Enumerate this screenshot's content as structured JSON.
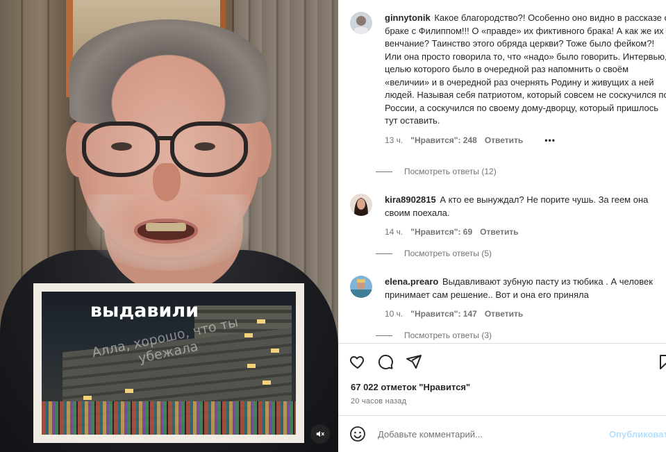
{
  "video": {
    "overlay_title": "выдавили",
    "projection_text": "Алла, хорошо, что ты убежала"
  },
  "comments": [
    {
      "username": "ginnytonik",
      "text": "Какое благородство?! Особенно оно видно в рассказе о браке с Филиппом!!! О «правде» их фиктивного брака! А как же их венчание? Таинство этого обряда церкви? Тоже было фейком?! Или она просто говорила то, что «надо» было говорить. Интервью, целью которого было в очередной раз напомнить о своём «величии» и в очередной раз очернять Родину и живущих а ней людей. Называя себя патриотом, который совсем не соскучился по России, а соскучился по своему дому-дворцу, который пришлось тут оставить.",
      "time": "13 ч.",
      "likes": "\"Нравится\": 248",
      "reply": "Ответить",
      "more": "•••",
      "view_replies": "Посмотреть ответы (12)"
    },
    {
      "username": "kira8902815",
      "text": "А кто ее вынуждал? Не порите чушь. За геем она своим поехала.",
      "time": "14 ч.",
      "likes": "\"Нравится\": 69",
      "reply": "Ответить",
      "view_replies": "Посмотреть ответы (5)"
    },
    {
      "username": "elena.prearo",
      "text": "Выдавливают зубную пасту из тюбика . А человек принимает сам решение.. Вот и она его приняла",
      "time": "10 ч.",
      "likes": "\"Нравится\": 147",
      "reply": "Ответить",
      "view_replies": "Посмотреть ответы (3)"
    }
  ],
  "actions": {
    "icons": [
      "heart-icon",
      "comment-icon",
      "share-icon",
      "bookmark-icon"
    ]
  },
  "likes_total": "67 022 отметок \"Нравится\"",
  "posted_ago": "20 часов назад",
  "add_comment": {
    "placeholder": "Добавьте комментарий...",
    "post_label": "Опубликовать"
  }
}
